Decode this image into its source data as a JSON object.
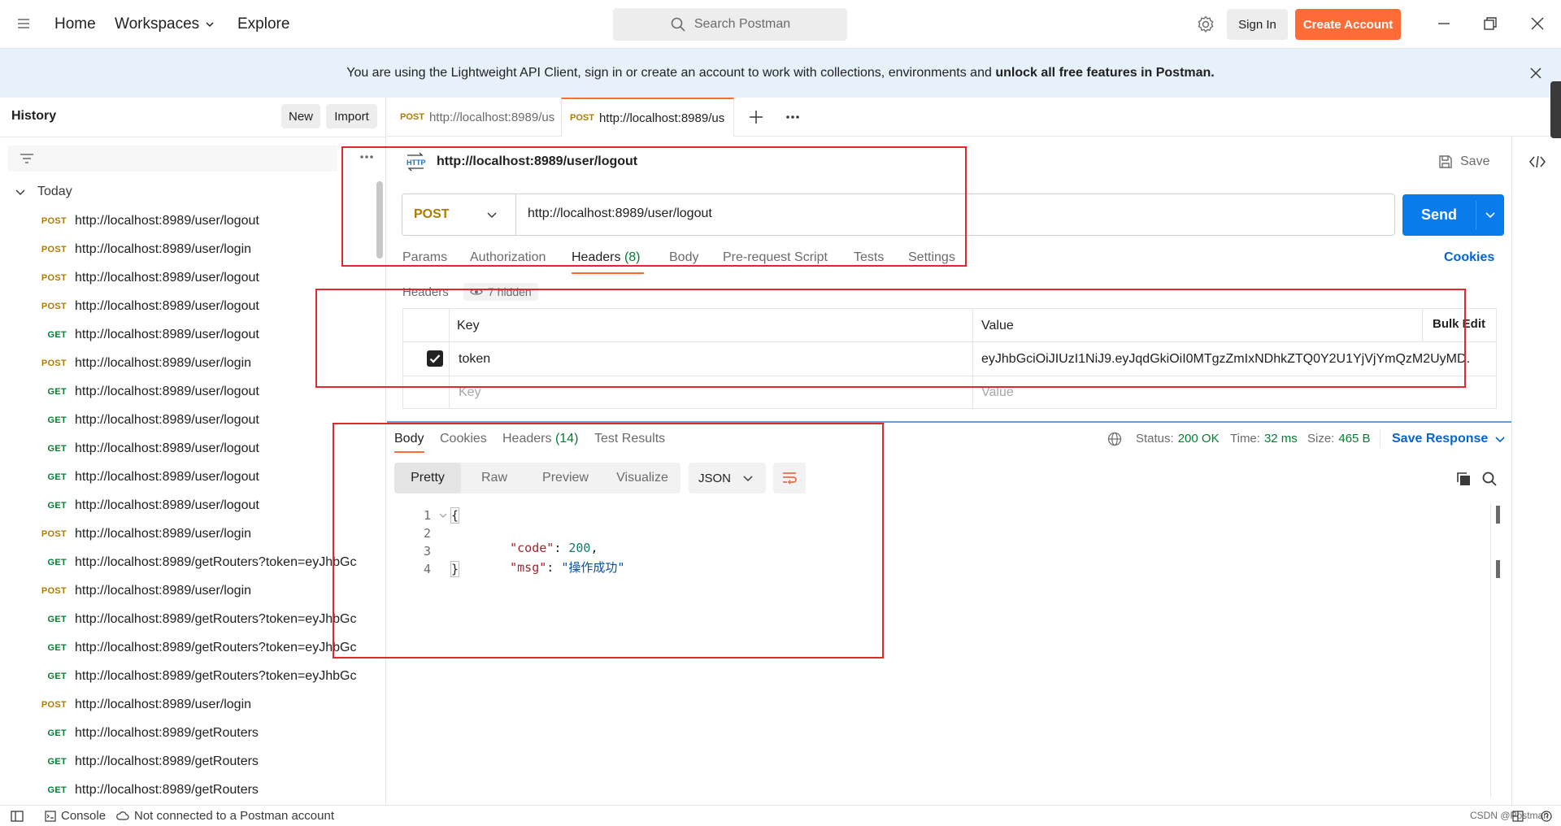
{
  "topbar": {
    "nav": [
      "Home",
      "Workspaces",
      "Explore"
    ],
    "search_placeholder": "Search Postman",
    "sign_in": "Sign In",
    "create_account": "Create Account"
  },
  "banner": {
    "text": "You are using the Lightweight API Client, sign in or create an account to work with collections, environments and ",
    "bold": "unlock all free features in Postman."
  },
  "sidebar": {
    "title": "History",
    "new_label": "New",
    "import_label": "Import",
    "group": "Today",
    "items": [
      {
        "method": "POST",
        "url": "http://localhost:8989/user/logout"
      },
      {
        "method": "POST",
        "url": "http://localhost:8989/user/login"
      },
      {
        "method": "POST",
        "url": "http://localhost:8989/user/logout"
      },
      {
        "method": "POST",
        "url": "http://localhost:8989/user/logout"
      },
      {
        "method": "GET",
        "url": "http://localhost:8989/user/logout"
      },
      {
        "method": "POST",
        "url": "http://localhost:8989/user/login"
      },
      {
        "method": "GET",
        "url": "http://localhost:8989/user/logout"
      },
      {
        "method": "GET",
        "url": "http://localhost:8989/user/logout"
      },
      {
        "method": "GET",
        "url": "http://localhost:8989/user/logout"
      },
      {
        "method": "GET",
        "url": "http://localhost:8989/user/logout"
      },
      {
        "method": "GET",
        "url": "http://localhost:8989/user/logout"
      },
      {
        "method": "POST",
        "url": "http://localhost:8989/user/login"
      },
      {
        "method": "GET",
        "url": "http://localhost:8989/getRouters?token=eyJhbGc"
      },
      {
        "method": "POST",
        "url": "http://localhost:8989/user/login"
      },
      {
        "method": "GET",
        "url": "http://localhost:8989/getRouters?token=eyJhbGc"
      },
      {
        "method": "GET",
        "url": "http://localhost:8989/getRouters?token=eyJhbGc"
      },
      {
        "method": "GET",
        "url": "http://localhost:8989/getRouters?token=eyJhbGc"
      },
      {
        "method": "POST",
        "url": "http://localhost:8989/user/login"
      },
      {
        "method": "GET",
        "url": "http://localhost:8989/getRouters"
      },
      {
        "method": "GET",
        "url": "http://localhost:8989/getRouters"
      },
      {
        "method": "GET",
        "url": "http://localhost:8989/getRouters"
      }
    ]
  },
  "tabs": [
    {
      "method": "POST",
      "label": "http://localhost:8989/us"
    },
    {
      "method": "POST",
      "label": "http://localhost:8989/us"
    }
  ],
  "request": {
    "title": "http://localhost:8989/user/logout",
    "save_label": "Save",
    "method": "POST",
    "url": "http://localhost:8989/user/logout",
    "send_label": "Send",
    "tabs": [
      "Params",
      "Authorization",
      "Headers",
      "Body",
      "Pre-request Script",
      "Tests",
      "Settings"
    ],
    "headers_count": "(8)",
    "cookies_label": "Cookies",
    "headers_section": "Headers",
    "hidden_label": "7 hidden",
    "table": {
      "col_key": "Key",
      "col_value": "Value",
      "bulk_edit": "Bulk Edit",
      "rows": [
        {
          "key": "token",
          "value": "eyJhbGciOiJIUzI1NiJ9.eyJqdGkiOiI0MTgzZmIxNDhkZTQ0Y2U1YjVjYmQzM2UyMD...",
          "checked": true
        }
      ],
      "placeholder_key": "Key",
      "placeholder_value": "Value"
    }
  },
  "response": {
    "tabs": [
      "Body",
      "Cookies",
      "Headers",
      "Test Results"
    ],
    "headers_count": "(14)",
    "status_label": "Status:",
    "status_value": "200 OK",
    "time_label": "Time:",
    "time_value": "32 ms",
    "size_label": "Size:",
    "size_value": "465 B",
    "save_response": "Save Response",
    "view_tabs": [
      "Pretty",
      "Raw",
      "Preview",
      "Visualize"
    ],
    "format": "JSON",
    "lines": [
      "1",
      "2",
      "3",
      "4"
    ],
    "code": {
      "open": "{",
      "k1": "\"code\"",
      "v1": "200",
      "k2": "\"msg\"",
      "v2": "\"操作成功\"",
      "close": "}"
    }
  },
  "statusbar": {
    "console": "Console",
    "connection": "Not connected to a Postman account",
    "watermark": "CSDN @Postman"
  },
  "colors": {
    "accent_orange": "#ff6c37",
    "send_blue": "#097bed",
    "post_method": "#ad7a03",
    "get_method": "#007f31",
    "annotation_red": "#e0262f"
  }
}
